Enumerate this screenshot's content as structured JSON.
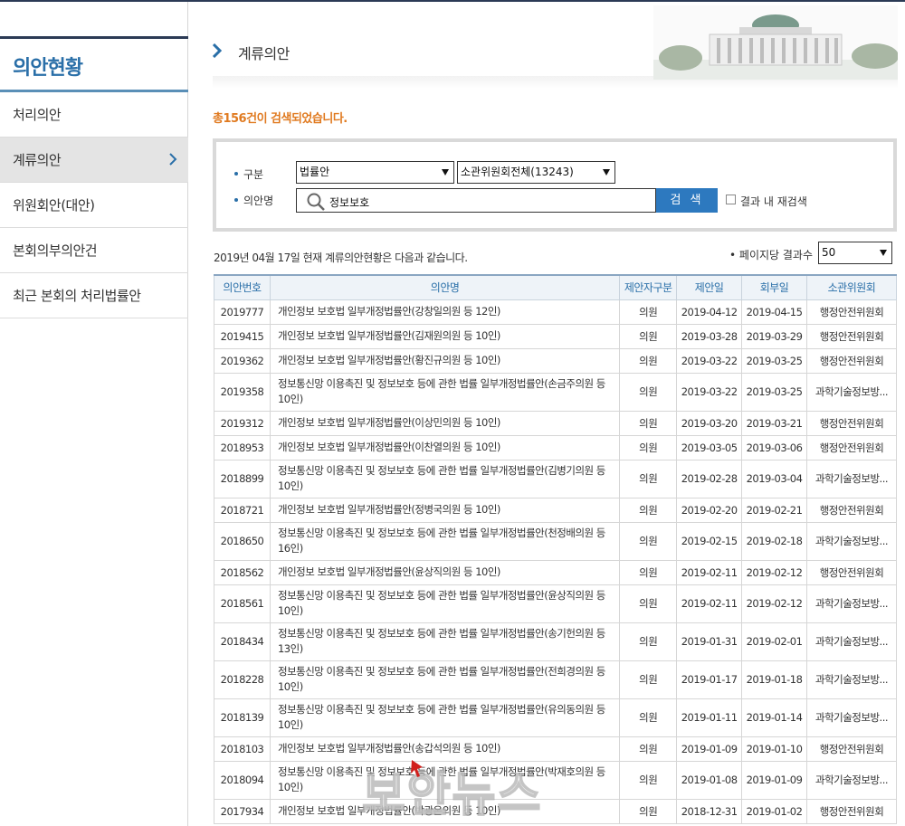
{
  "sidebar": {
    "title": "의안현황",
    "items": [
      {
        "label": "처리의안"
      },
      {
        "label": "계류의안"
      },
      {
        "label": "위원회안(대안)"
      },
      {
        "label": "본회의부의안건"
      },
      {
        "label": "최근 본회의 처리법률안"
      }
    ]
  },
  "header": {
    "title": "계류의안"
  },
  "result": {
    "prefix": "총",
    "count": "156",
    "suffix": "건이 검색되었습니다."
  },
  "search": {
    "category_label": "구분",
    "name_label": "의안명",
    "type_select": "법률안",
    "committee_select": "소관위원회전체(13243)",
    "query": "정보보호",
    "button": "검 색",
    "within_results_label": "결과 내 재검색"
  },
  "date_info": "2019년 04월 17일 현재 계류의안현황은 다음과 같습니다.",
  "perpage": {
    "label": "페이지당 결과수",
    "value": "50"
  },
  "table": {
    "headers": [
      "의안번호",
      "의안명",
      "제안자구분",
      "제안일",
      "회부일",
      "소관위원회"
    ],
    "rows": [
      {
        "no": "2019777",
        "name": "개인정보 보호법 일부개정법률안(강창일의원 등 12인)",
        "proposer": "의원",
        "proposed": "2019-04-12",
        "referred": "2019-04-15",
        "committee": "행정안전위원회"
      },
      {
        "no": "2019415",
        "name": "개인정보 보호법 일부개정법률안(김재원의원 등 10인)",
        "proposer": "의원",
        "proposed": "2019-03-28",
        "referred": "2019-03-29",
        "committee": "행정안전위원회"
      },
      {
        "no": "2019362",
        "name": "개인정보 보호법 일부개정법률안(황진규의원 등 10인)",
        "proposer": "의원",
        "proposed": "2019-03-22",
        "referred": "2019-03-25",
        "committee": "행정안전위원회"
      },
      {
        "no": "2019358",
        "name": "정보통신망 이용촉진 및 정보보호 등에 관한 법률 일부개정법률안(손금주의원 등 10인)",
        "proposer": "의원",
        "proposed": "2019-03-22",
        "referred": "2019-03-25",
        "committee": "과학기술정보방..."
      },
      {
        "no": "2019312",
        "name": "개인정보 보호법 일부개정법률안(이상민의원 등 10인)",
        "proposer": "의원",
        "proposed": "2019-03-20",
        "referred": "2019-03-21",
        "committee": "행정안전위원회"
      },
      {
        "no": "2018953",
        "name": "개인정보 보호법 일부개정법률안(이찬열의원 등 10인)",
        "proposer": "의원",
        "proposed": "2019-03-05",
        "referred": "2019-03-06",
        "committee": "행정안전위원회"
      },
      {
        "no": "2018899",
        "name": "정보통신망 이용촉진 및 정보보호 등에 관한 법률 일부개정법률안(김병기의원 등 10인)",
        "proposer": "의원",
        "proposed": "2019-02-28",
        "referred": "2019-03-04",
        "committee": "과학기술정보방..."
      },
      {
        "no": "2018721",
        "name": "개인정보 보호법 일부개정법률안(정병국의원 등 10인)",
        "proposer": "의원",
        "proposed": "2019-02-20",
        "referred": "2019-02-21",
        "committee": "행정안전위원회"
      },
      {
        "no": "2018650",
        "name": "정보통신망 이용촉진 및 정보보호 등에 관한 법률 일부개정법률안(천정배의원 등 16인)",
        "proposer": "의원",
        "proposed": "2019-02-15",
        "referred": "2019-02-18",
        "committee": "과학기술정보방..."
      },
      {
        "no": "2018562",
        "name": "개인정보 보호법 일부개정법률안(윤상직의원 등 10인)",
        "proposer": "의원",
        "proposed": "2019-02-11",
        "referred": "2019-02-12",
        "committee": "행정안전위원회"
      },
      {
        "no": "2018561",
        "name": "정보통신망 이용촉진 및 정보보호 등에 관한 법률 일부개정법률안(윤상직의원 등 10인)",
        "proposer": "의원",
        "proposed": "2019-02-11",
        "referred": "2019-02-12",
        "committee": "과학기술정보방..."
      },
      {
        "no": "2018434",
        "name": "정보통신망 이용촉진 및 정보보호 등에 관한 법률 일부개정법률안(송기헌의원 등 13인)",
        "proposer": "의원",
        "proposed": "2019-01-31",
        "referred": "2019-02-01",
        "committee": "과학기술정보방..."
      },
      {
        "no": "2018228",
        "name": "정보통신망 이용촉진 및 정보보호 등에 관한 법률 일부개정법률안(전희경의원 등 10인)",
        "proposer": "의원",
        "proposed": "2019-01-17",
        "referred": "2019-01-18",
        "committee": "과학기술정보방..."
      },
      {
        "no": "2018139",
        "name": "정보통신망 이용촉진 및 정보보호 등에 관한 법률 일부개정법률안(유의동의원 등 10인)",
        "proposer": "의원",
        "proposed": "2019-01-11",
        "referred": "2019-01-14",
        "committee": "과학기술정보방..."
      },
      {
        "no": "2018103",
        "name": "개인정보 보호법 일부개정법률안(송갑석의원 등 10인)",
        "proposer": "의원",
        "proposed": "2019-01-09",
        "referred": "2019-01-10",
        "committee": "행정안전위원회"
      },
      {
        "no": "2018094",
        "name": "정보통신망 이용촉진 및 정보보호 등에 관한 법률 일부개정법률안(박재호의원 등 10인)",
        "proposer": "의원",
        "proposed": "2019-01-08",
        "referred": "2019-01-09",
        "committee": "과학기술정보방..."
      },
      {
        "no": "2017934",
        "name": "개인정보 보호법 일부개정법률안(박광온의원 등 10인)",
        "proposer": "의원",
        "proposed": "2018-12-31",
        "referred": "2019-01-02",
        "committee": "행정안전위원회"
      }
    ]
  },
  "watermark": "보안뉴스",
  "colors": {
    "accent": "#2a6fa8",
    "button": "#2d79bf",
    "count": "#e07a20",
    "header_bg": "#eef3f8"
  }
}
